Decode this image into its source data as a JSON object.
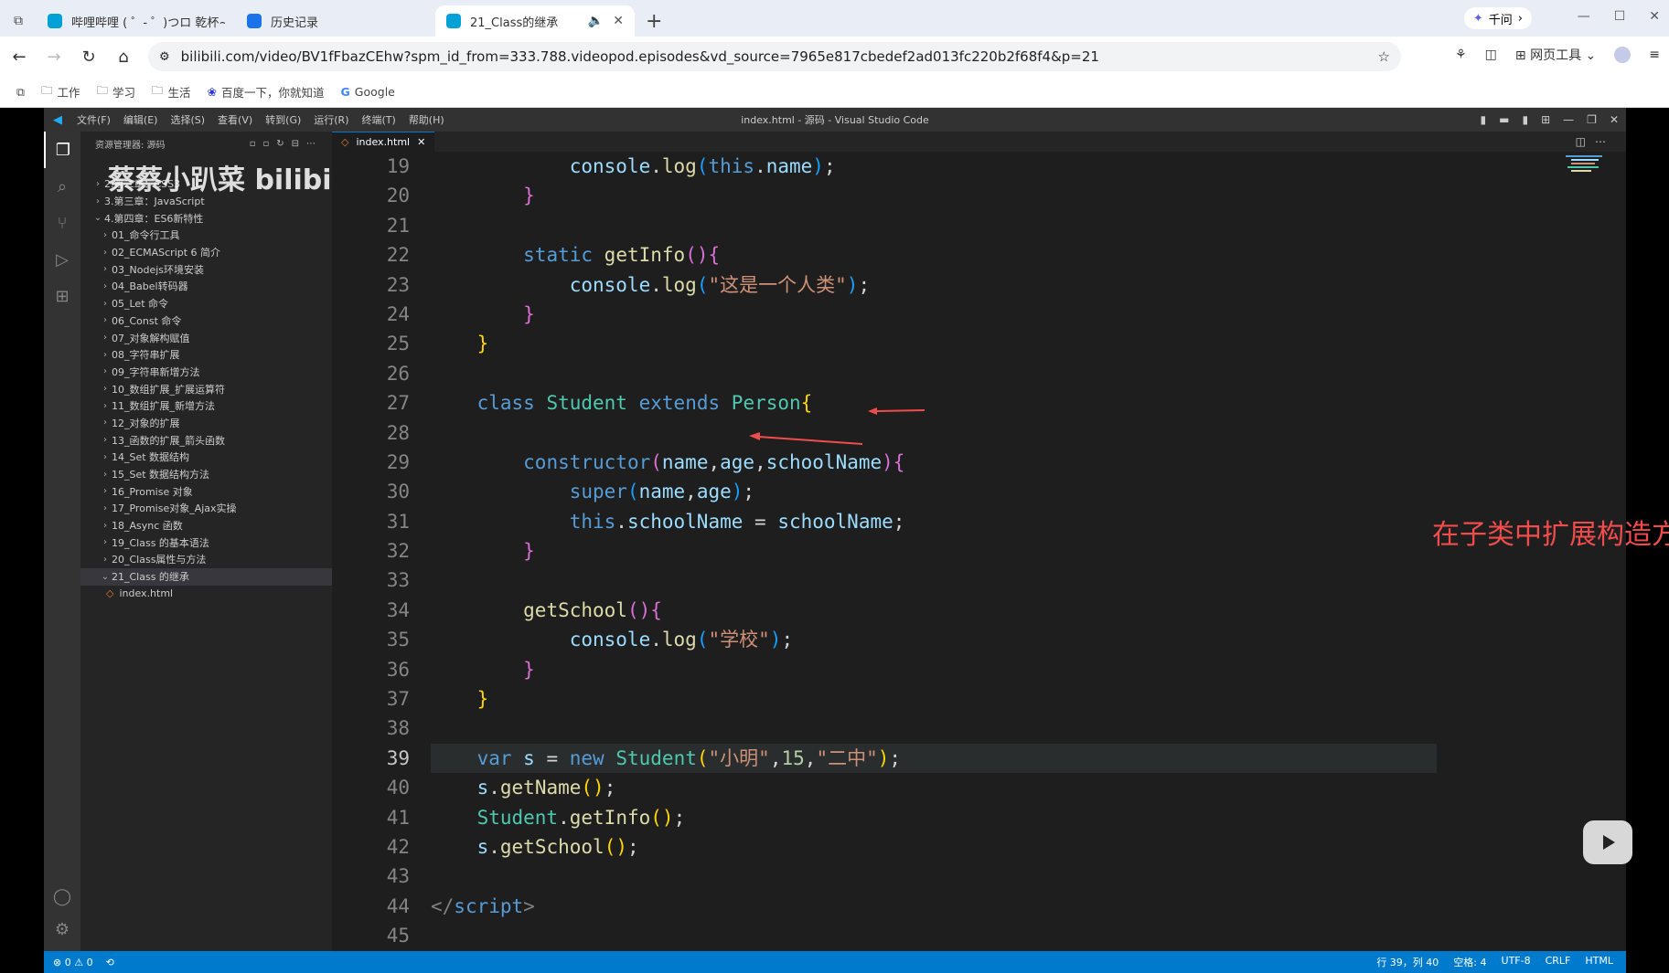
{
  "browser": {
    "tabs": [
      {
        "title": "哔哩哔哩 ( ゜- ゜)つロ 乾杯~",
        "active": false
      },
      {
        "title": "历史记录",
        "active": false
      },
      {
        "title": "21_Class的继承",
        "active": true
      }
    ],
    "new_tab": "+",
    "qianwen_label": "千问",
    "url": "bilibili.com/video/BV1fFbazCEhw?spm_id_from=333.788.videopod.episodes&vd_source=7965e817cbedef2ad013fc220b2f68f4&p=21",
    "web_tools_label": "网页工具",
    "bookmarks": [
      "工作",
      "学习",
      "生活",
      "百度一下，你就知道",
      "Google"
    ]
  },
  "vscode": {
    "menu": [
      "文件(F)",
      "编辑(E)",
      "选择(S)",
      "查看(V)",
      "转到(G)",
      "运行(R)",
      "终端(T)",
      "帮助(H)"
    ],
    "window_title": "index.html - 源码 - Visual Studio Code",
    "explorer_title": "资源管理器: 源码",
    "watermark": "蔡蔡小趴菜 bilibili",
    "tree": [
      {
        "label": "2.第二章：CSS3",
        "depth": 1,
        "open": false
      },
      {
        "label": "3.第三章：JavaScript",
        "depth": 1,
        "open": false
      },
      {
        "label": "4.第四章：ES6新特性",
        "depth": 1,
        "open": true
      },
      {
        "label": "01_命令行工具",
        "depth": 2,
        "open": false
      },
      {
        "label": "02_ECMAScript 6 简介",
        "depth": 2,
        "open": false
      },
      {
        "label": "03_Nodejs环境安装",
        "depth": 2,
        "open": false
      },
      {
        "label": "04_Babel转码器",
        "depth": 2,
        "open": false
      },
      {
        "label": "05_Let 命令",
        "depth": 2,
        "open": false
      },
      {
        "label": "06_Const 命令",
        "depth": 2,
        "open": false
      },
      {
        "label": "07_对象解构赋值",
        "depth": 2,
        "open": false
      },
      {
        "label": "08_字符串扩展",
        "depth": 2,
        "open": false
      },
      {
        "label": "09_字符串新增方法",
        "depth": 2,
        "open": false
      },
      {
        "label": "10_数组扩展_扩展运算符",
        "depth": 2,
        "open": false
      },
      {
        "label": "11_数组扩展_新增方法",
        "depth": 2,
        "open": false
      },
      {
        "label": "12_对象的扩展",
        "depth": 2,
        "open": false
      },
      {
        "label": "13_函数的扩展_箭头函数",
        "depth": 2,
        "open": false
      },
      {
        "label": "14_Set 数据结构",
        "depth": 2,
        "open": false
      },
      {
        "label": "15_Set 数据结构方法",
        "depth": 2,
        "open": false
      },
      {
        "label": "16_Promise 对象",
        "depth": 2,
        "open": false
      },
      {
        "label": "17_Promise对象_Ajax实操",
        "depth": 2,
        "open": false
      },
      {
        "label": "18_Async 函数",
        "depth": 2,
        "open": false
      },
      {
        "label": "19_Class 的基本语法",
        "depth": 2,
        "open": false
      },
      {
        "label": "20_Class属性与方法",
        "depth": 2,
        "open": false
      },
      {
        "label": "21_Class 的继承",
        "depth": 2,
        "open": true,
        "selected": true
      },
      {
        "label": "index.html",
        "depth": 3,
        "file": true
      }
    ],
    "editor_tab": "index.html",
    "current_line": 39,
    "lines": [
      {
        "n": 19,
        "html": "            <span class=\"v\">console</span>.<span class=\"f\">log</span><span class=\"p3\">(</span><span class=\"k\">this</span>.<span class=\"v\">name</span><span class=\"p3\">)</span>;"
      },
      {
        "n": 20,
        "html": "        <span class=\"p2\">}</span>"
      },
      {
        "n": 21,
        "html": ""
      },
      {
        "n": 22,
        "html": "        <span class=\"k\">static</span> <span class=\"f\">getInfo</span><span class=\"p2\">()</span><span class=\"p2\">{</span>"
      },
      {
        "n": 23,
        "html": "            <span class=\"v\">console</span>.<span class=\"f\">log</span><span class=\"p3\">(</span><span class=\"s\">\"这是一个人类\"</span><span class=\"p3\">)</span>;"
      },
      {
        "n": 24,
        "html": "        <span class=\"p2\">}</span>"
      },
      {
        "n": 25,
        "html": "    <span class=\"p1\">}</span>"
      },
      {
        "n": 26,
        "html": ""
      },
      {
        "n": 27,
        "html": "    <span class=\"k\">class</span> <span class=\"c\">Student</span> <span class=\"k\">extends</span> <span class=\"c\">Person</span><span class=\"p1\">{</span>"
      },
      {
        "n": 28,
        "html": ""
      },
      {
        "n": 29,
        "html": "        <span class=\"k\">constructor</span><span class=\"p2\">(</span><span class=\"v\">name</span>,<span class=\"v\">age</span>,<span class=\"v\">schoolName</span><span class=\"p2\">){</span>"
      },
      {
        "n": 30,
        "html": "            <span class=\"k\">super</span><span class=\"p3\">(</span><span class=\"v\">name</span>,<span class=\"v\">age</span><span class=\"p3\">)</span>;"
      },
      {
        "n": 31,
        "html": "            <span class=\"k\">this</span>.<span class=\"v\">schoolName</span> = <span class=\"v\">schoolName</span>;"
      },
      {
        "n": 32,
        "html": "        <span class=\"p2\">}</span>"
      },
      {
        "n": 33,
        "html": ""
      },
      {
        "n": 34,
        "html": "        <span class=\"f\">getSchool</span><span class=\"p2\">()</span><span class=\"p2\">{</span>"
      },
      {
        "n": 35,
        "html": "            <span class=\"v\">console</span>.<span class=\"f\">log</span><span class=\"p3\">(</span><span class=\"s\">\"学校\"</span><span class=\"p3\">)</span>;"
      },
      {
        "n": 36,
        "html": "        <span class=\"p2\">}</span>"
      },
      {
        "n": 37,
        "html": "    <span class=\"p1\">}</span>"
      },
      {
        "n": 38,
        "html": ""
      },
      {
        "n": 39,
        "html": "    <span class=\"k\">var</span> <span class=\"v\">s</span> = <span class=\"k\">new</span> <span class=\"c\">Student</span><span class=\"p1\">(</span><span class=\"s\">\"小明\"</span>,<span class=\"n\">15</span>,<span class=\"s\">\"二中\"</span><span class=\"p1\">)</span>;"
      },
      {
        "n": 40,
        "html": "    <span class=\"v\">s</span>.<span class=\"f\">getName</span><span class=\"p1\">()</span>;"
      },
      {
        "n": 41,
        "html": "    <span class=\"c\">Student</span>.<span class=\"f\">getInfo</span><span class=\"p1\">()</span>;"
      },
      {
        "n": 42,
        "html": "    <span class=\"v\">s</span>.<span class=\"f\">getSchool</span><span class=\"p1\">()</span>;"
      },
      {
        "n": 43,
        "html": ""
      },
      {
        "n": 44,
        "html": "<span class=\"tag\">&lt;/</span><span class=\"tn\">script</span><span class=\"tag\">&gt;</span>"
      },
      {
        "n": 45,
        "html": ""
      }
    ],
    "annotation": "在子类中扩展构造方法",
    "status_left": "⊗ 0 ⚠ 0",
    "status_right": [
      "行 39，列 40",
      "空格: 4",
      "UTF-8",
      "CRLF",
      "HTML"
    ],
    "colors": {
      "status": "#007acc",
      "annotation": "#f14c4c"
    }
  }
}
